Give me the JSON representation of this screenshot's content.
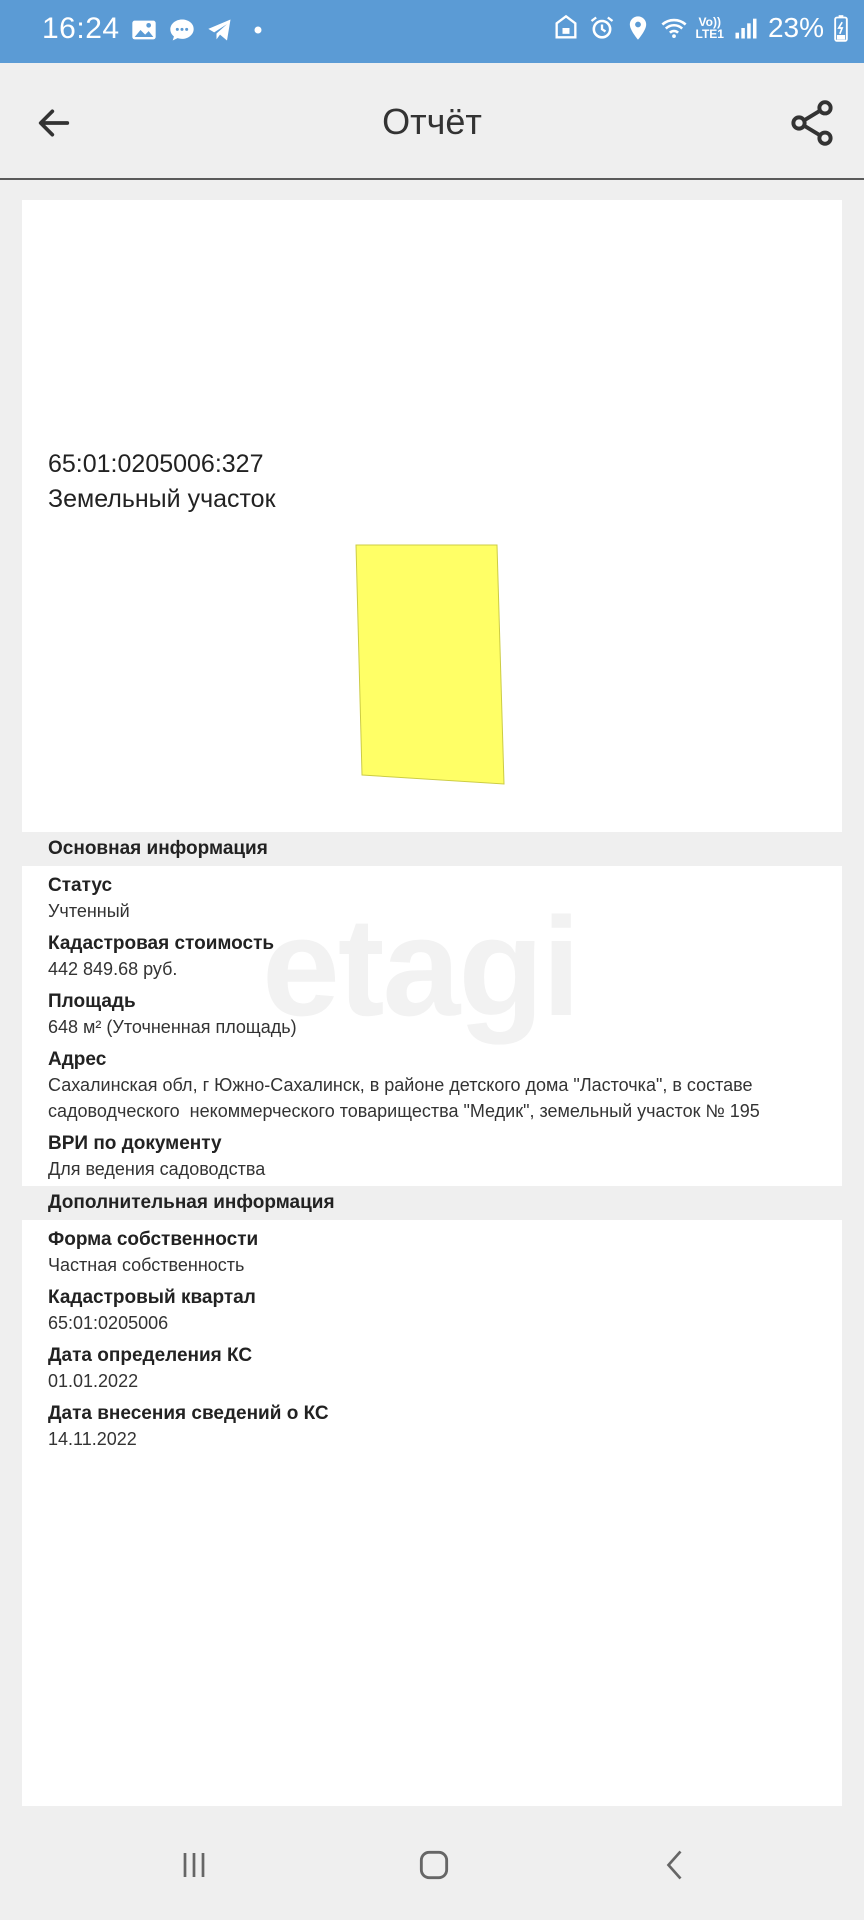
{
  "status_bar": {
    "time": "16:24",
    "battery": "23%",
    "lte_top": "Vo))",
    "lte_bottom": "LTE1"
  },
  "app_bar": {
    "title": "Отчёт"
  },
  "object": {
    "cadastral_number": "65:01:0205006:327",
    "type": "Земельный участок",
    "plot_color": "#ffff66"
  },
  "watermark": "etagi",
  "main_info": {
    "header": "Основная информация",
    "fields": [
      {
        "label": "Статус",
        "value": "Учтенный"
      },
      {
        "label": "Кадастровая стоимость",
        "value": "442 849.68 руб."
      },
      {
        "label": "Площадь",
        "value": "648 м² (Уточненная площадь)"
      },
      {
        "label": "Адрес",
        "value": "Сахалинская обл, г Южно-Сахалинск, в районе детского дома \"Ласточка\", в составе садоводческого  некоммерческого товарищества \"Медик\", земельный участок № 195"
      },
      {
        "label": "ВРИ по документу",
        "value": "Для ведения садоводства"
      }
    ]
  },
  "extra_info": {
    "header": "Дополнительная информация",
    "fields": [
      {
        "label": "Форма собственности",
        "value": "Частная собственность"
      },
      {
        "label": "Кадастровый квартал",
        "value": "65:01:0205006"
      },
      {
        "label": "Дата определения КС",
        "value": "01.01.2022"
      },
      {
        "label": "Дата внесения сведений о КС",
        "value": "14.11.2022"
      }
    ]
  },
  "colors": {
    "status_bar": "#5b9bd5",
    "background": "#efefef",
    "card": "#ffffff"
  }
}
